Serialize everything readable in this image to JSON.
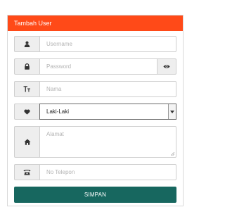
{
  "panel": {
    "title": "Tambah User"
  },
  "form": {
    "username": {
      "placeholder": "Username",
      "icon": "user-icon"
    },
    "password": {
      "placeholder": "Password",
      "icon": "lock-icon",
      "toggle_icon": "eye-icon"
    },
    "nama": {
      "placeholder": "Nama",
      "icon": "text-icon"
    },
    "gender": {
      "selected": "Laki-Laki",
      "icon": "heart-icon"
    },
    "alamat": {
      "placeholder": "Alamat",
      "icon": "home-icon"
    },
    "telepon": {
      "placeholder": "No Telepon",
      "icon": "phone-icon"
    },
    "submit_label": "SIMPAN"
  },
  "colors": {
    "heading": "#ff4a18",
    "submit": "#17675f"
  }
}
